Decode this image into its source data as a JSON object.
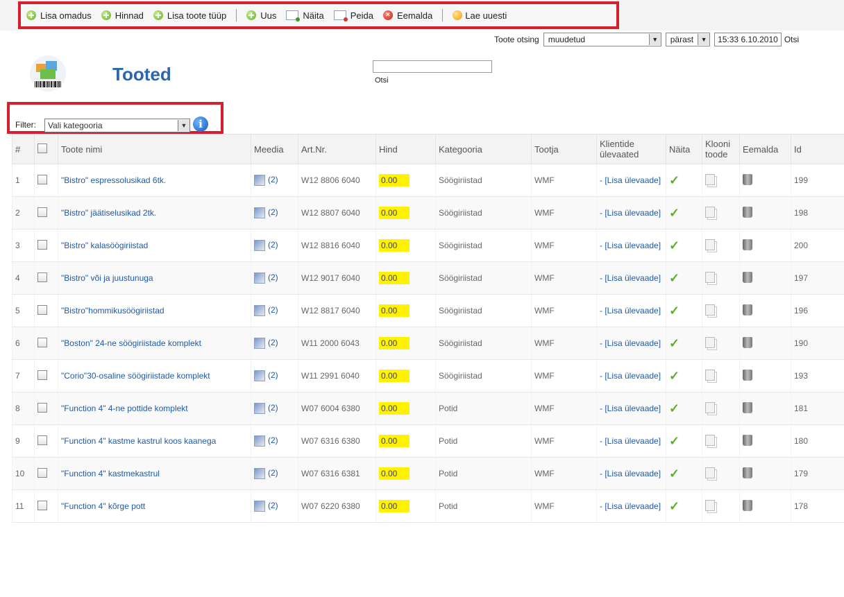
{
  "toolbar": {
    "add_property": "Lisa omadus",
    "prices": "Hinnad",
    "add_product_type": "Lisa toote tüüp",
    "new": "Uus",
    "show": "Näita",
    "hide": "Peida",
    "remove": "Eemalda",
    "reload": "Lae uuesti"
  },
  "search": {
    "label": "Toote otsing",
    "field_value": "muudetud",
    "relation_value": "pärast",
    "datetime_value": "15:33 6.10.2010",
    "button": "Otsi"
  },
  "header": {
    "title": "Tooted",
    "quick_search_value": "",
    "quick_search_button": "Otsi"
  },
  "filter": {
    "label": "Filter:",
    "category_value": "Vali kategooria"
  },
  "table": {
    "headers": {
      "num": "#",
      "name": "Toote nimi",
      "media": "Meedia",
      "artnr": "Art.Nr.",
      "price": "Hind",
      "category": "Kategooria",
      "maker": "Tootja",
      "reviews": "Klientide ülevaated",
      "show": "Näita",
      "clone": "Klooni toode",
      "remove": "Eemalda",
      "id": "Id"
    },
    "rows": [
      {
        "num": "1",
        "name": "\"Bistro\" espressolusikad 6tk.",
        "media": "(2)",
        "artnr": "W12 8806 6040",
        "price": "0.00",
        "category": "Söögiriistad",
        "maker": "WMF",
        "review": "- [Lisa ülevaade]",
        "id": "199"
      },
      {
        "num": "2",
        "name": "\"Bistro\" jäätiselusikad 2tk.",
        "media": "(2)",
        "artnr": "W12 8807 6040",
        "price": "0.00",
        "category": "Söögiriistad",
        "maker": "WMF",
        "review": "- [Lisa ülevaade]",
        "id": "198"
      },
      {
        "num": "3",
        "name": "\"Bistro\" kalasöögiriistad",
        "media": "(2)",
        "artnr": "W12 8816 6040",
        "price": "0.00",
        "category": "Söögiriistad",
        "maker": "WMF",
        "review": "- [Lisa ülevaade]",
        "id": "200"
      },
      {
        "num": "4",
        "name": "\"Bistro\" või ja juustunuga",
        "media": "(2)",
        "artnr": "W12 9017 6040",
        "price": "0.00",
        "category": "Söögiriistad",
        "maker": "WMF",
        "review": "- [Lisa ülevaade]",
        "id": "197"
      },
      {
        "num": "5",
        "name": "\"Bistro\"hommikusöögiriistad",
        "media": "(2)",
        "artnr": "W12 8817 6040",
        "price": "0.00",
        "category": "Söögiriistad",
        "maker": "WMF",
        "review": "- [Lisa ülevaade]",
        "id": "196"
      },
      {
        "num": "6",
        "name": "\"Boston\" 24-ne söögiriistade komplekt",
        "media": "(2)",
        "artnr": "W11 2000 6043",
        "price": "0.00",
        "category": "Söögiriistad",
        "maker": "WMF",
        "review": "- [Lisa ülevaade]",
        "id": "190"
      },
      {
        "num": "7",
        "name": "\"Corio\"30-osaline söögiriistade komplekt",
        "media": "(2)",
        "artnr": "W11 2991 6040",
        "price": "0.00",
        "category": "Söögiriistad",
        "maker": "WMF",
        "review": "- [Lisa ülevaade]",
        "id": "193"
      },
      {
        "num": "8",
        "name": "\"Function 4\" 4-ne pottide komplekt",
        "media": "(2)",
        "artnr": "W07 6004 6380",
        "price": "0.00",
        "category": "Potid",
        "maker": "WMF",
        "review": "- [Lisa ülevaade]",
        "id": "181"
      },
      {
        "num": "9",
        "name": "\"Function 4\" kastme kastrul koos kaanega",
        "media": "(2)",
        "artnr": "W07 6316 6380",
        "price": "0.00",
        "category": "Potid",
        "maker": "WMF",
        "review": "- [Lisa ülevaade]",
        "id": "180"
      },
      {
        "num": "10",
        "name": "\"Function 4\" kastmekastrul",
        "media": "(2)",
        "artnr": "W07 6316 6381",
        "price": "0.00",
        "category": "Potid",
        "maker": "WMF",
        "review": "- [Lisa ülevaade]",
        "id": "179"
      },
      {
        "num": "11",
        "name": "\"Function 4\" kõrge pott",
        "media": "(2)",
        "artnr": "W07 6220 6380",
        "price": "0.00",
        "category": "Potid",
        "maker": "WMF",
        "review": "- [Lisa ülevaade]",
        "id": "178"
      }
    ]
  },
  "colors": {
    "highlight_border": "#d41f2c",
    "title_blue": "#2b67ad",
    "link_blue": "#1d5aa8",
    "price_highlight": "#fff200",
    "check_green": "#5cae28"
  },
  "icons": {
    "plus": "plus-circle-icon",
    "remove": "remove-circle-icon",
    "reload": "reload-icon",
    "show": "show-doc-icon",
    "hide": "hide-doc-icon",
    "info": "info-icon",
    "media": "media-icon",
    "check": "check-icon",
    "clone": "clone-icon",
    "trash": "trash-icon"
  }
}
